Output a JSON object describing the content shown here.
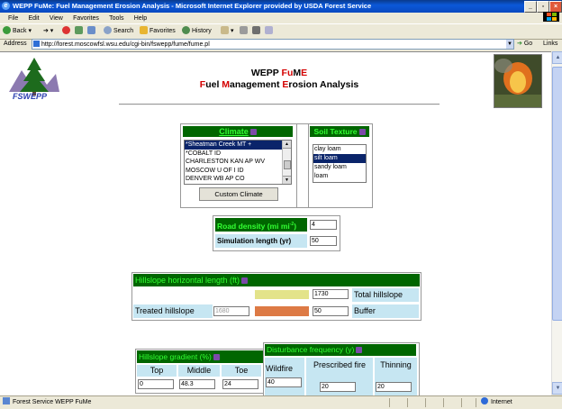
{
  "window": {
    "title": "WEPP FuMe: Fuel Management Erosion Analysis - Microsoft Internet Explorer provided by USDA Forest Service"
  },
  "menu": {
    "items": [
      "File",
      "Edit",
      "View",
      "Favorites",
      "Tools",
      "Help"
    ]
  },
  "toolbar": {
    "back": "Back",
    "search": "Search",
    "favorites": "Favorites",
    "history": "History"
  },
  "address": {
    "label": "Address",
    "url": "http://forest.moscowfsl.wsu.edu/cgi-bin/fswepp/fume/fume.pl",
    "go": "Go",
    "links": "Links"
  },
  "logo": {
    "text": "FSWEPP"
  },
  "page": {
    "title_line1": "WEPP FuME",
    "title_line2": "Fuel Management Erosion Analysis"
  },
  "climate": {
    "header": "Climate",
    "options": [
      "*Sheatman Creek MT +",
      "*COBALT ID",
      "CHARLESTON KAN AP WV",
      "MOSCOW U OF I ID",
      "DENVER WB AP CO"
    ],
    "selected_index": 0,
    "custom_button": "Custom Climate"
  },
  "soil": {
    "header": "Soil Texture",
    "options": [
      "clay loam",
      "silt loam",
      "sandy loam",
      "loam"
    ],
    "selected_index": 1
  },
  "road": {
    "density_label": "Road density (mi mi",
    "density_sup": "-2",
    "density_label_end": ")",
    "density_value": "4",
    "sim_label": "Simulation length (yr)",
    "sim_value": "50"
  },
  "hillslope_length": {
    "header": "Hillslope horizontal length (ft)",
    "total_value": "1730",
    "total_label": "Total hillslope",
    "treated_label": "Treated hillslope",
    "treated_value": "1680",
    "buffer_value": "50",
    "buffer_label": "Buffer",
    "colors": {
      "total_bar": "#e3e38a",
      "buffer_bar": "#dd7a45"
    }
  },
  "gradient": {
    "header": "Hillslope gradient (%)",
    "cols": [
      "Top",
      "Middle",
      "Toe"
    ],
    "values": [
      "0",
      "48.3",
      "24"
    ]
  },
  "disturbance": {
    "header": "Disturbance frequency (y)",
    "cols": [
      "Wildfire",
      "Prescribed fire",
      "Thinning"
    ],
    "values": [
      "40",
      "20",
      "20"
    ]
  },
  "status": {
    "text": "Forest Service WEPP FuMe",
    "zone": "Internet"
  }
}
